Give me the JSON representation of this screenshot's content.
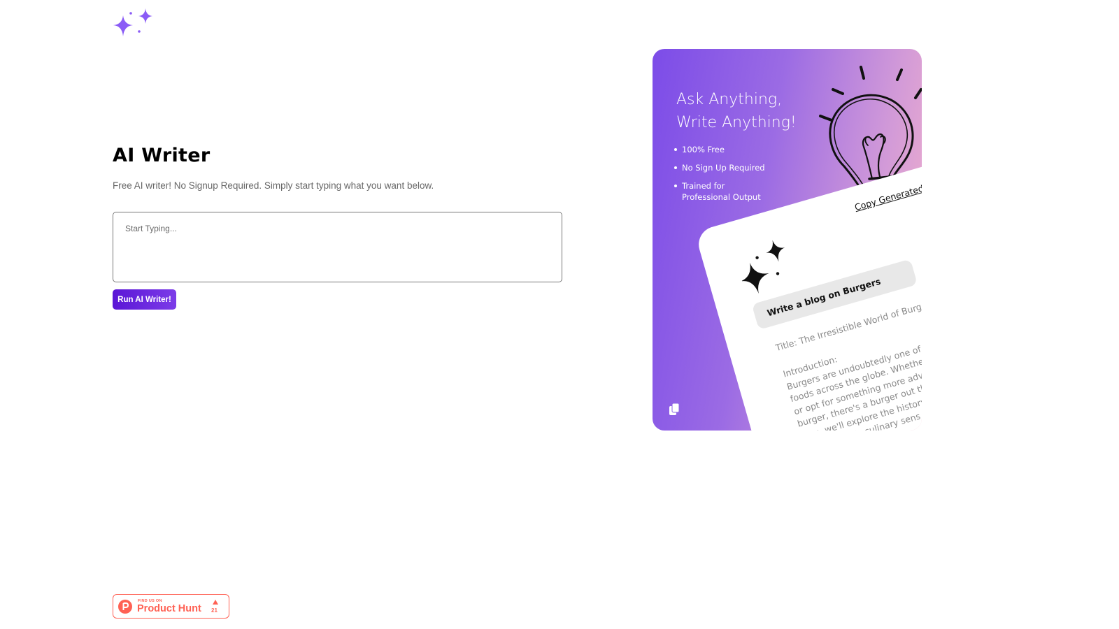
{
  "header": {
    "logo_icon": "sparkles-icon",
    "accent_color": "#8b5cf6"
  },
  "main": {
    "title": "AI Writer",
    "subtitle": "Free AI writer! No Signup Required. Simply start typing what you want below.",
    "input": {
      "placeholder": "Start Typing...",
      "value": ""
    },
    "run_button_label": "Run AI Writer!",
    "button_color": "#5b16d6"
  },
  "promo": {
    "heading_line1": "Ask Anything,",
    "heading_line2": "Write Anything!",
    "features": [
      "100% Free",
      "No Sign Up Required",
      "Trained for Professional Output"
    ],
    "bulb_icon": "lightbulb-icon",
    "copy_link": "Copy Generated Text",
    "sample_prompt": "Write a blog on Burgers",
    "generated_title": "Title: The Irresistible World of Burgers",
    "generated_body": [
      "Introduction:",
      "Burgers are undoubtedly one of the most",
      "foods across the globe. Whether you pre",
      "or opt for something more adventurous",
      "burger, there's a burger out there to sa",
      "blog, we'll explore the history, popula",
      "appeal of this culinary sens"
    ],
    "copy_icon": "copy-icon"
  },
  "badge": {
    "small_text": "FIND US ON",
    "name": "Product Hunt",
    "upvotes": "21",
    "logo_icon": "product-hunt-icon",
    "upvote_icon": "upvote-arrow-icon",
    "color": "#ff6154"
  }
}
